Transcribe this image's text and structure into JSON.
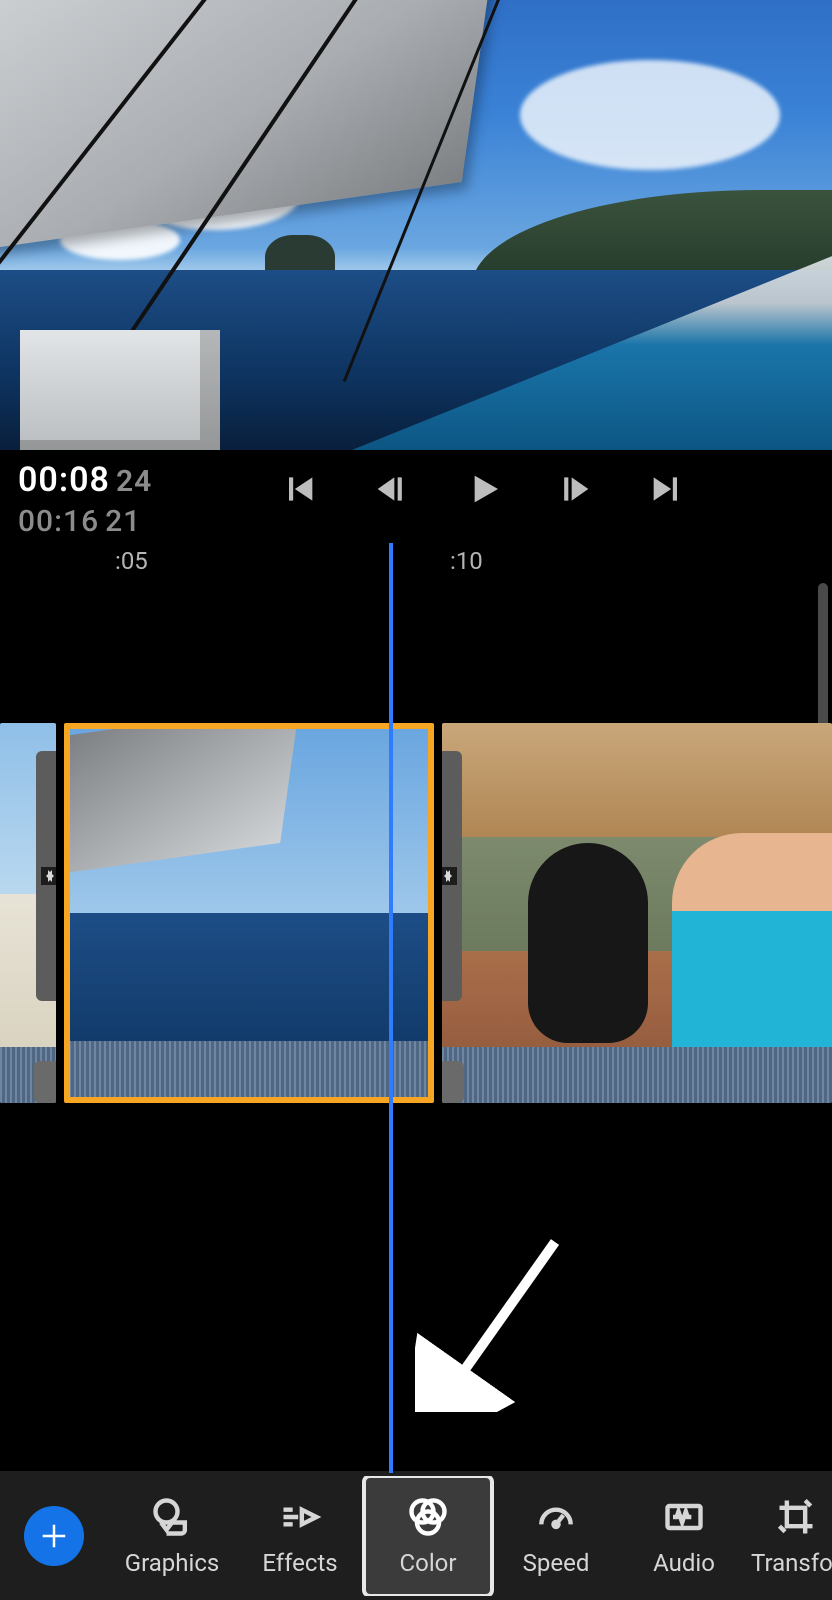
{
  "playback": {
    "current_seconds": "00:08",
    "current_frames": "24",
    "total_seconds": "00:16",
    "total_frames": "21"
  },
  "ruler": {
    "mark_5": ":05",
    "mark_10": ":10"
  },
  "toolbar": {
    "graphics": "Graphics",
    "effects": "Effects",
    "color": "Color",
    "speed": "Speed",
    "audio": "Audio",
    "transform": "Transfor"
  },
  "colors": {
    "accent": "#1473e6",
    "selection": "#f6a623",
    "playhead": "#2f7cff"
  }
}
